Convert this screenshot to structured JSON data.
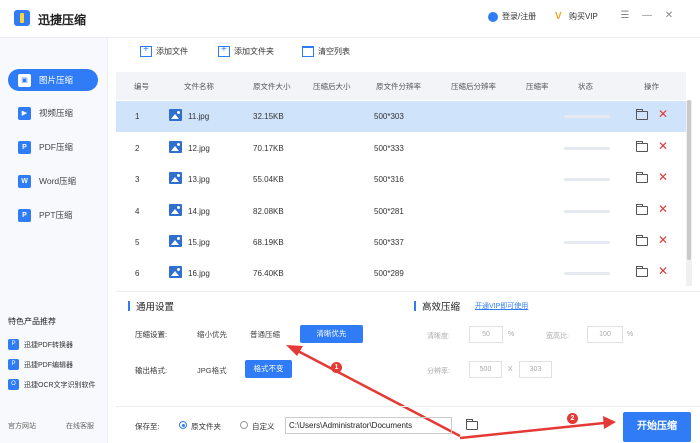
{
  "app": {
    "title": "迅捷压缩"
  },
  "titlebar": {
    "login": "登录/注册",
    "buy_vip": "购买VIP"
  },
  "sidebar": {
    "items": [
      {
        "label": "图片压缩",
        "icon": "image-icon"
      },
      {
        "label": "视频压缩",
        "icon": "video-icon"
      },
      {
        "label": "PDF压缩",
        "icon": "pdf-icon"
      },
      {
        "label": "Word压缩",
        "icon": "word-icon"
      },
      {
        "label": "PPT压缩",
        "icon": "ppt-icon"
      }
    ],
    "recommend_title": "特色产品推荐",
    "recommend": [
      {
        "label": "迅捷PDF转换器"
      },
      {
        "label": "迅捷PDF编辑器"
      },
      {
        "label": "迅捷OCR文字识别软件"
      }
    ],
    "footer": {
      "website": "官方网站",
      "support": "在线客服"
    }
  },
  "toolbar": {
    "add_file": "添加文件",
    "add_folder": "添加文件夹",
    "clear_list": "清空列表"
  },
  "table": {
    "headers": [
      "编号",
      "文件名称",
      "原文件大小",
      "压缩后大小",
      "原文件分辨率",
      "压缩后分辨率",
      "压缩率",
      "状态",
      "操作"
    ],
    "rows": [
      {
        "num": "1",
        "name": "11.jpg",
        "size": "32.15KB",
        "res": "500*303"
      },
      {
        "num": "2",
        "name": "12.jpg",
        "size": "70.17KB",
        "res": "500*333"
      },
      {
        "num": "3",
        "name": "13.jpg",
        "size": "55.04KB",
        "res": "500*316"
      },
      {
        "num": "4",
        "name": "14.jpg",
        "size": "82.08KB",
        "res": "500*281"
      },
      {
        "num": "5",
        "name": "15.jpg",
        "size": "68.19KB",
        "res": "500*337"
      },
      {
        "num": "6",
        "name": "16.jpg",
        "size": "76.40KB",
        "res": "500*289"
      }
    ]
  },
  "settings": {
    "general_title": "通用设置",
    "compress_label": "压缩设置:",
    "opt_small": "缩小优先",
    "opt_normal": "普通压缩",
    "opt_clear": "清晰优先",
    "output_label": "输出格式:",
    "format_jpg": "JPG格式",
    "format_keep": "格式不变",
    "efficient_title": "高效压缩",
    "vip_link": "开通VIP即可使用",
    "clarity_label": "清晰度:",
    "clarity_value": "50",
    "clarity_unit": "%",
    "ratio_label": "宽高比:",
    "ratio_value": "100",
    "ratio_unit": "%",
    "resolution_label": "分辨率:",
    "res_w": "500",
    "res_x": "X",
    "res_h": "303",
    "badge1": "1",
    "badge2": "2"
  },
  "bottom": {
    "save_label": "保存至:",
    "radio_original": "原文件夹",
    "radio_custom": "自定义",
    "path": "C:\\Users\\Administrator\\Documents",
    "start": "开始压缩"
  },
  "colors": {
    "accent": "#2f7cf6",
    "selected_row": "#cfe3fb",
    "arrow": "#e53935",
    "delete": "#e03a3a"
  }
}
